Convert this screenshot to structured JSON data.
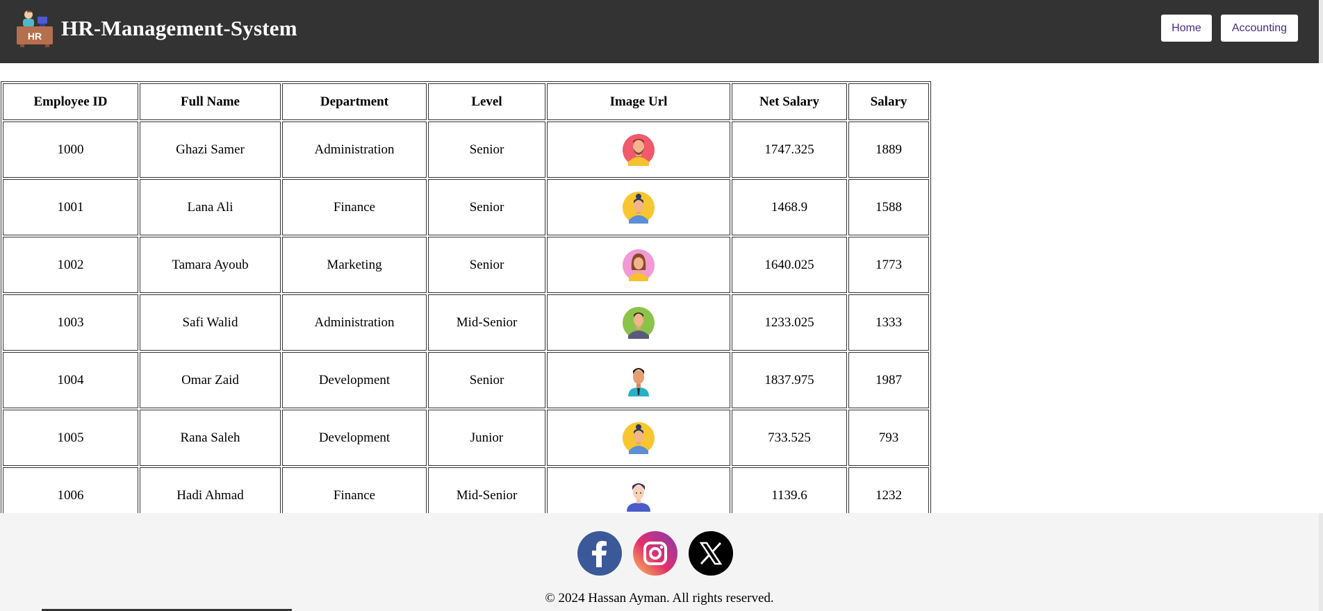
{
  "header": {
    "title": "HR-Management-System",
    "logo_text": "HR",
    "nav": {
      "home": "Home",
      "accounting": "Accounting"
    }
  },
  "table": {
    "columns": [
      "Employee ID",
      "Full Name",
      "Department",
      "Level",
      "Image Url",
      "Net Salary",
      "Salary"
    ],
    "rows": [
      {
        "id": "1000",
        "name": "Ghazi Samer",
        "department": "Administration",
        "level": "Senior",
        "avatar": "man-beard-red-avatar",
        "net_salary": "1747.325",
        "salary": "1889"
      },
      {
        "id": "1001",
        "name": "Lana Ali",
        "department": "Finance",
        "level": "Senior",
        "avatar": "woman-bun-yellow-avatar",
        "net_salary": "1468.9",
        "salary": "1588"
      },
      {
        "id": "1002",
        "name": "Tamara Ayoub",
        "department": "Marketing",
        "level": "Senior",
        "avatar": "woman-pink-avatar",
        "net_salary": "1640.025",
        "salary": "1773"
      },
      {
        "id": "1003",
        "name": "Safi Walid",
        "department": "Administration",
        "level": "Mid-Senior",
        "avatar": "man-green-avatar",
        "net_salary": "1233.025",
        "salary": "1333"
      },
      {
        "id": "1004",
        "name": "Omar Zaid",
        "department": "Development",
        "level": "Senior",
        "avatar": "man-tie-avatar",
        "net_salary": "1837.975",
        "salary": "1987"
      },
      {
        "id": "1005",
        "name": "Rana Saleh",
        "department": "Development",
        "level": "Junior",
        "avatar": "woman-bun-yellow-avatar",
        "net_salary": "733.525",
        "salary": "793"
      },
      {
        "id": "1006",
        "name": "Hadi Ahmad",
        "department": "Finance",
        "level": "Mid-Senior",
        "avatar": "man-purple-avatar",
        "net_salary": "1139.6",
        "salary": "1232"
      }
    ]
  },
  "footer": {
    "social": [
      "facebook-icon",
      "instagram-icon",
      "x-icon"
    ],
    "copyright": "© 2024 Hassan Ayman. All rights reserved."
  },
  "colors": {
    "header_bg": "#333333",
    "footer_bg": "#f4f4f4",
    "link_color": "#4b2a86"
  }
}
